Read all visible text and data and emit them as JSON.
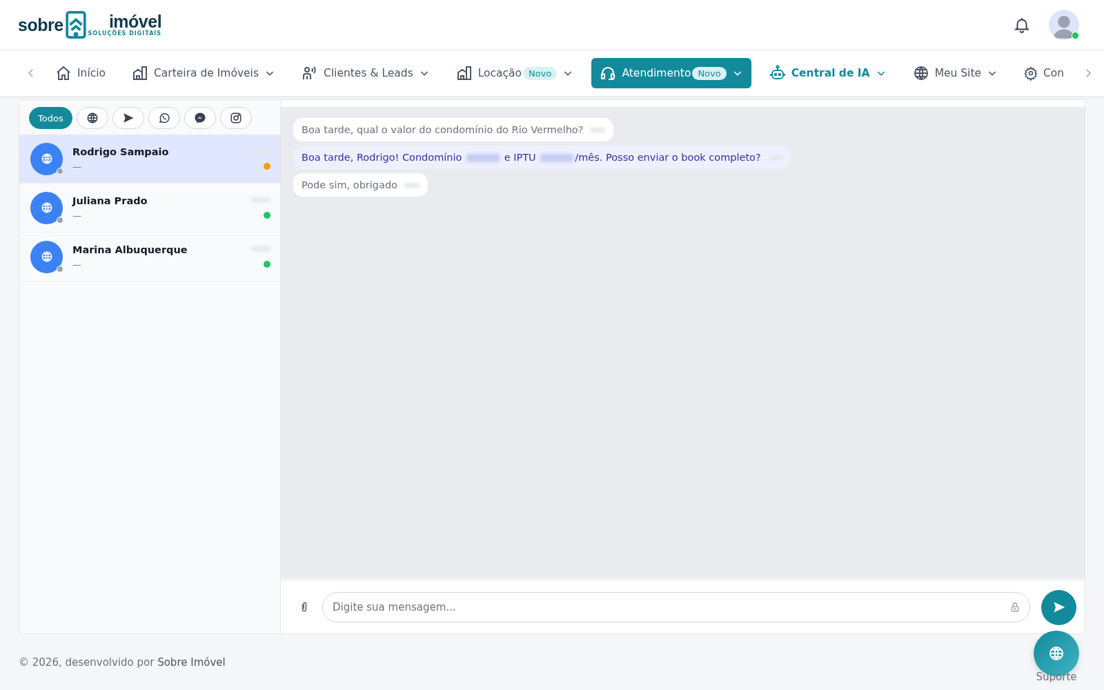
{
  "header": {
    "logo_left": "sobre",
    "logo_right": "imóvel",
    "logo_tagline": "SOLUÇÕES DIGITAIS"
  },
  "nav": [
    {
      "label": "Início",
      "dropdown": false,
      "selected": false,
      "accent": false
    },
    {
      "label": "Carteira de Imóveis",
      "dropdown": true,
      "selected": false,
      "accent": false
    },
    {
      "label": "Clientes & Leads",
      "dropdown": true,
      "selected": false,
      "accent": false
    },
    {
      "label": "Locação",
      "badge": "Novo",
      "dropdown": true,
      "selected": false,
      "accent": false
    },
    {
      "label": "Atendimento",
      "badge": "Novo",
      "dropdown": true,
      "selected": true,
      "accent": false
    },
    {
      "label": "Central de IA",
      "dropdown": true,
      "selected": false,
      "accent": true
    },
    {
      "label": "Meu Site",
      "dropdown": true,
      "selected": false,
      "accent": false
    },
    {
      "label": "Con",
      "dropdown": false,
      "selected": false,
      "accent": false
    }
  ],
  "filters": [
    {
      "label": "Todos",
      "selected": true
    },
    {
      "selected": false
    },
    {
      "selected": false
    },
    {
      "selected": false
    },
    {
      "selected": false
    },
    {
      "selected": false
    }
  ],
  "chats": [
    {
      "name": "Rodrigo Sampaio",
      "preview": "—",
      "color": "#f59e0b",
      "selected": true
    },
    {
      "name": "Juliana Prado",
      "preview": "—",
      "color": "#22c55e",
      "selected": false
    },
    {
      "name": "Marina Albuquerque",
      "preview": "—",
      "color": "#22c55e",
      "selected": false
    }
  ],
  "messages": [
    {
      "outgoing": false,
      "parts": [
        {
          "kind": "text",
          "text": "Boa tarde, qual o valor do condomínio do Rio Vermelho?"
        }
      ]
    },
    {
      "outgoing": true,
      "parts": [
        {
          "kind": "text",
          "text": "Boa tarde, Rodrigo! Condomínio "
        },
        {
          "kind": "redacted"
        },
        {
          "kind": "text",
          "text": " e IPTU "
        },
        {
          "kind": "redacted"
        },
        {
          "kind": "text",
          "text": "/mês. Posso enviar o book completo?"
        }
      ]
    },
    {
      "outgoing": false,
      "parts": [
        {
          "kind": "text",
          "text": "Pode sim, obrigado"
        }
      ]
    }
  ],
  "composer": {
    "placeholder": "Digite sua mensagem..."
  },
  "footer": {
    "text": "© 2026, desenvolvido por ",
    "link": "Sobre Imóvel",
    "support": "Suporte"
  }
}
